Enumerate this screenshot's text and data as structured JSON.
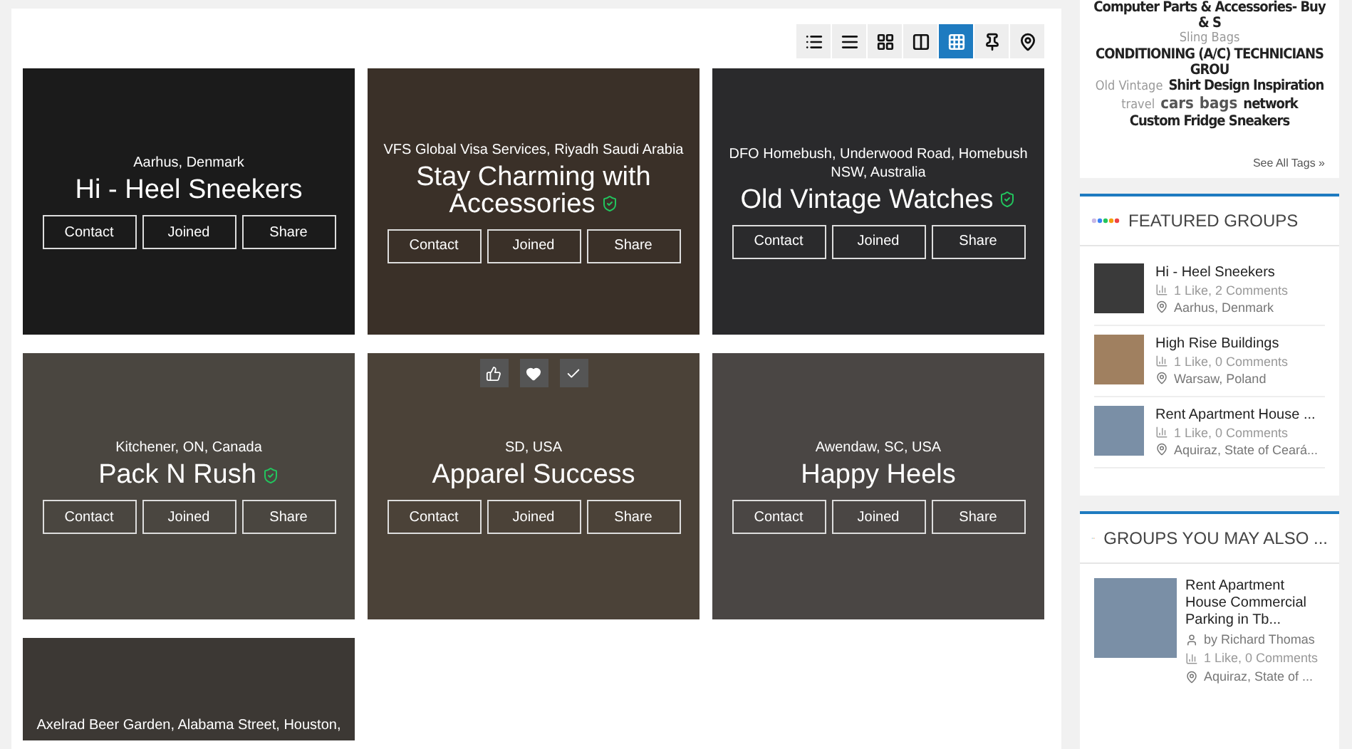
{
  "view_toolbar": [
    {
      "kind": "list",
      "selected": false
    },
    {
      "kind": "rows",
      "selected": false
    },
    {
      "kind": "grid2",
      "selected": false
    },
    {
      "kind": "columns",
      "selected": false
    },
    {
      "kind": "grid3",
      "selected": true
    },
    {
      "kind": "pin",
      "selected": false
    },
    {
      "kind": "map",
      "selected": false
    }
  ],
  "groups": [
    {
      "location": "Aarhus, Denmark",
      "title": "Hi - Heel Sneekers",
      "verified": false,
      "actions_visible": false,
      "buttons": [
        "Contact",
        "Joined",
        "Share"
      ]
    },
    {
      "location": "VFS Global Visa Services, Riyadh Saudi Arabia",
      "title": "Stay Charming with Accessories",
      "verified": true,
      "actions_visible": false,
      "buttons": [
        "Contact",
        "Joined",
        "Share"
      ]
    },
    {
      "location": "DFO Homebush, Underwood Road, Homebush NSW, Australia",
      "title": "Old Vintage Watches",
      "verified": true,
      "actions_visible": false,
      "buttons": [
        "Contact",
        "Joined",
        "Share"
      ]
    },
    {
      "location": "Kitchener, ON, Canada",
      "title": "Pack N Rush",
      "verified": true,
      "actions_visible": false,
      "buttons": [
        "Contact",
        "Joined",
        "Share"
      ]
    },
    {
      "location": "SD, USA",
      "title": "Apparel Success",
      "verified": false,
      "actions_visible": true,
      "buttons": [
        "Contact",
        "Joined",
        "Share"
      ]
    },
    {
      "location": "Awendaw, SC, USA",
      "title": "Happy Heels",
      "verified": false,
      "actions_visible": false,
      "buttons": [
        "Contact",
        "Joined",
        "Share"
      ]
    },
    {
      "location": "Axelrad Beer Garden, Alabama Street, Houston,"
    }
  ],
  "tag_cloud": {
    "tags": [
      {
        "text": "Computer Parts & Accessories- Buy & S",
        "kind": "big"
      },
      {
        "text": "Sling Bags",
        "kind": "small"
      },
      {
        "text": "CONDITIONING (A/C) TECHNICIANS GROU",
        "kind": "big"
      },
      {
        "text": "Old Vintage",
        "kind": "small"
      },
      {
        "text": "Shirt Design Inspiration",
        "kind": "big"
      },
      {
        "text": "travel",
        "kind": "small"
      },
      {
        "text": "cars",
        "kind": "medium"
      },
      {
        "text": "bags",
        "kind": "medium"
      },
      {
        "text": "network",
        "kind": "big"
      },
      {
        "text": "Custom Fridge Sneakers",
        "kind": "big"
      }
    ],
    "link": "See All Tags »"
  },
  "featured_groups": {
    "title": "FEATURED GROUPS",
    "items": [
      {
        "name": "Hi - Heel Sneekers",
        "stats": "1 Like, 2 Comments",
        "location": "Aarhus, Denmark"
      },
      {
        "name": "High Rise Buildings",
        "stats": "1 Like, 0 Comments",
        "location": "Warsaw, Poland"
      },
      {
        "name": "Rent Apartment House ...",
        "stats": "1 Like, 0 Comments",
        "location": "Aquiraz, State of Ceará..."
      }
    ]
  },
  "suggested_groups": {
    "title": "GROUPS YOU MAY ALSO ...",
    "items": [
      {
        "name": "Rent Apartment House Commercial Parking in Tb...",
        "owner": "by Richard Thomas",
        "stats": "1 Like, 0 Comments",
        "location": "Aquiraz, State of ..."
      }
    ]
  }
}
